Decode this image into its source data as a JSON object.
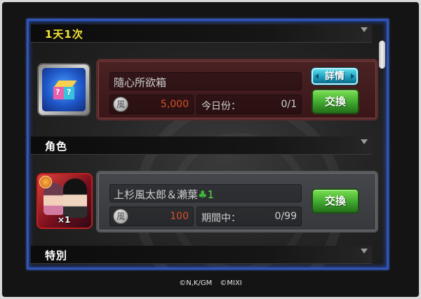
{
  "sections": [
    {
      "label": "1天1次"
    },
    {
      "label": "角色"
    },
    {
      "label": "特別"
    }
  ],
  "items": [
    {
      "name": "隨心所欲箱",
      "cost": "5,000",
      "limit_label": "今日份：",
      "limit_value": "0/1",
      "detail_button": "詳情",
      "exchange_button": "交換",
      "icon": "mystery-box-icon"
    },
    {
      "name": "上杉風太郎＆瀨葉",
      "name_count": "1",
      "cost": "100",
      "limit_label": "期間中：",
      "limit_value": "0/99",
      "exchange_button": "交換",
      "char_count": "×1",
      "icon": "character-portrait-icon"
    }
  ],
  "currency_glyph": "風",
  "copyright": "©N,K/GM ©MIXI",
  "colors": {
    "panel_border": "#2f55b8",
    "section_yellow": "#f2e233",
    "cost_text": "#d9512a",
    "exchange_green": "#3fa72f",
    "detail_cyan": "#1e9fbf",
    "clover_green": "#3dbb3a"
  }
}
